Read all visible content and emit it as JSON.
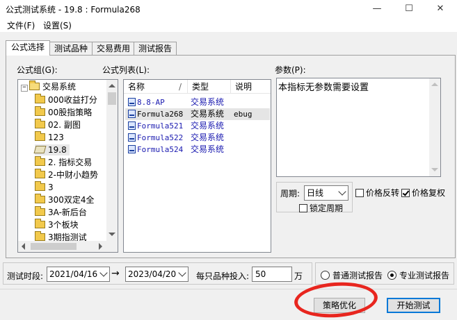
{
  "window": {
    "title": "公式测试系统 - 19.8 : Formula268",
    "min": "—",
    "max": "☐",
    "close": "✕"
  },
  "menu": {
    "file": "文件(F)",
    "settings": "设置(S)"
  },
  "tabs": [
    "公式选择",
    "测试品种",
    "交易费用",
    "测试报告"
  ],
  "formula_group": {
    "label": "公式组(G):",
    "root": "交易系统",
    "items": [
      "000收益打分",
      "00股指策略",
      "02. 副图",
      "123",
      "19.8",
      "2. 指标交易",
      "2-中财小趋势",
      "3",
      "300双定4全",
      "3A-新后台",
      "3个板块",
      "3期指测试"
    ]
  },
  "formula_list": {
    "label": "公式列表(L):",
    "columns": [
      "名称",
      "类型",
      "说明"
    ],
    "rows": [
      {
        "name": "8.8-AP",
        "type": "交易系统",
        "desc": "",
        "selected": false
      },
      {
        "name": "Formula268",
        "type": "交易系统",
        "desc": "ebug",
        "selected": true
      },
      {
        "name": "Formula521",
        "type": "交易系统",
        "desc": "",
        "selected": false
      },
      {
        "name": "Formula522",
        "type": "交易系统",
        "desc": "",
        "selected": false
      },
      {
        "name": "Formula524",
        "type": "交易系统",
        "desc": "",
        "selected": false
      }
    ]
  },
  "params": {
    "label": "参数(P):",
    "text": "本指标无参数需要设置"
  },
  "period": {
    "label": "周期:",
    "value": "日线",
    "lock": "锁定周期",
    "lock_checked": false
  },
  "price_reverse": {
    "label": "价格反转",
    "checked": false
  },
  "price_restore": {
    "label": "价格复权",
    "checked": true
  },
  "test_period": {
    "label": "测试时段:",
    "from": "2021/04/16",
    "arrow": "→",
    "to": "2023/04/20"
  },
  "investment": {
    "label": "每只品种投入:",
    "value": "50",
    "unit": "万"
  },
  "report_type": {
    "normal": "普通测试报告",
    "pro": "专业测试报告",
    "selected": "pro"
  },
  "buttons": {
    "optimize": "策略优化",
    "start": "开始测试"
  },
  "colors": {
    "annotation": "#e8261f",
    "selection": "#e5e5e5",
    "tree_selection": "#cce8ff"
  }
}
